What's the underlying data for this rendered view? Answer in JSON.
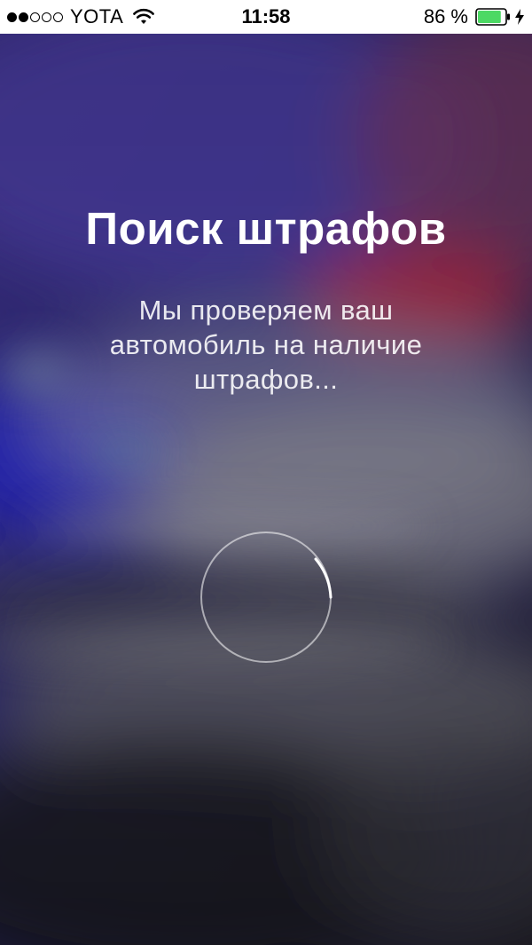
{
  "status_bar": {
    "carrier": "YOTA",
    "time": "11:58",
    "battery_percent": "86 %",
    "battery_level": 0.86,
    "signal_bars_filled": 2,
    "signal_bars_total": 5,
    "icons": [
      "signal-dots-icon",
      "wifi-icon",
      "battery-icon",
      "charging-bolt-icon"
    ],
    "battery_color": "#4cd964"
  },
  "main": {
    "title": "Поиск штрафов",
    "subtitle": "Мы проверяем ваш автомобиль на наличие штрафов...",
    "loading_indicator": "spinner-icon"
  },
  "colors": {
    "text": "#ffffff",
    "status_bar_bg": "#ffffff"
  }
}
